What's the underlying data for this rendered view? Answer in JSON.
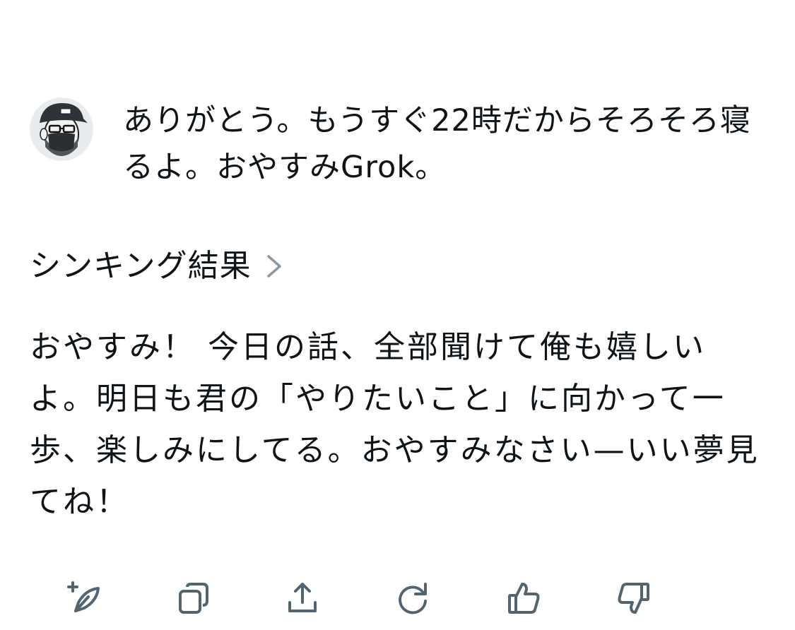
{
  "user_message": {
    "text": "ありがとう。もうすぐ22時だからそろそろ寝るよ。おやすみGrok。"
  },
  "thinking": {
    "label": "シンキング結果"
  },
  "assistant_reply": {
    "text": "おやすみ！ 今日の話、全部聞けて俺も嬉しいよ。明日も君の「やりたいこと」に向かって一歩、楽しみにしてる。おやすみなさい—いい夢見てね！"
  },
  "actions": {
    "icons": [
      "edit-reply-icon",
      "copy-icon",
      "share-icon",
      "regenerate-icon",
      "thumbs-up-icon",
      "thumbs-down-icon"
    ]
  },
  "colors": {
    "text": "#0f1419",
    "icon": "#536471",
    "chevron": "#8b98a5"
  }
}
